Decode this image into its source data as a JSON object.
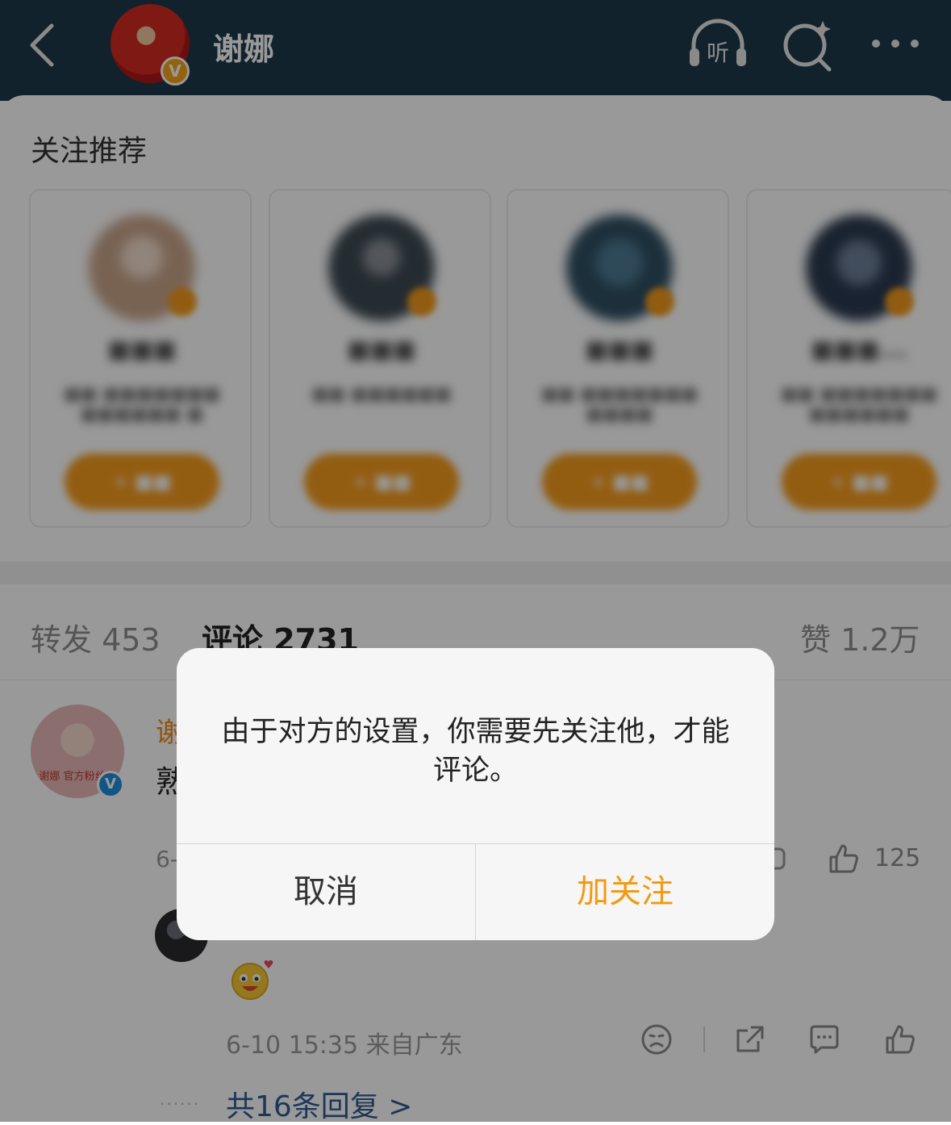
{
  "header": {
    "title": "谢娜",
    "listen_label": "听",
    "verified_badge": "V"
  },
  "recommendations": {
    "title": "关注推荐",
    "cards": [
      {
        "avatar_color": "#c9a58a"
      },
      {
        "avatar_color": "#3e4a52"
      },
      {
        "avatar_color": "#2f4f63"
      },
      {
        "avatar_color": "#2b3a50"
      }
    ]
  },
  "tabs": {
    "repost": "转发 453",
    "comments": "评论 2731",
    "likes": "赞 1.2万"
  },
  "comment": {
    "author_visible": "谢",
    "body_visible": "熟",
    "meta_visible": "6-",
    "avatar_text": "谢娜 官方粉丝团",
    "like_count": "125"
  },
  "reply": {
    "meta": "6-10 15:35  来自广东",
    "more_replies": "共16条回复 >",
    "dots": "······"
  },
  "dialog": {
    "message": "由于对方的设置，你需要先关注他，才能评论。",
    "cancel": "取消",
    "follow": "加关注"
  },
  "colors": {
    "header_bg": "#1d3a4a",
    "accent_orange": "#f29a12",
    "link_blue": "#2f5c93"
  }
}
